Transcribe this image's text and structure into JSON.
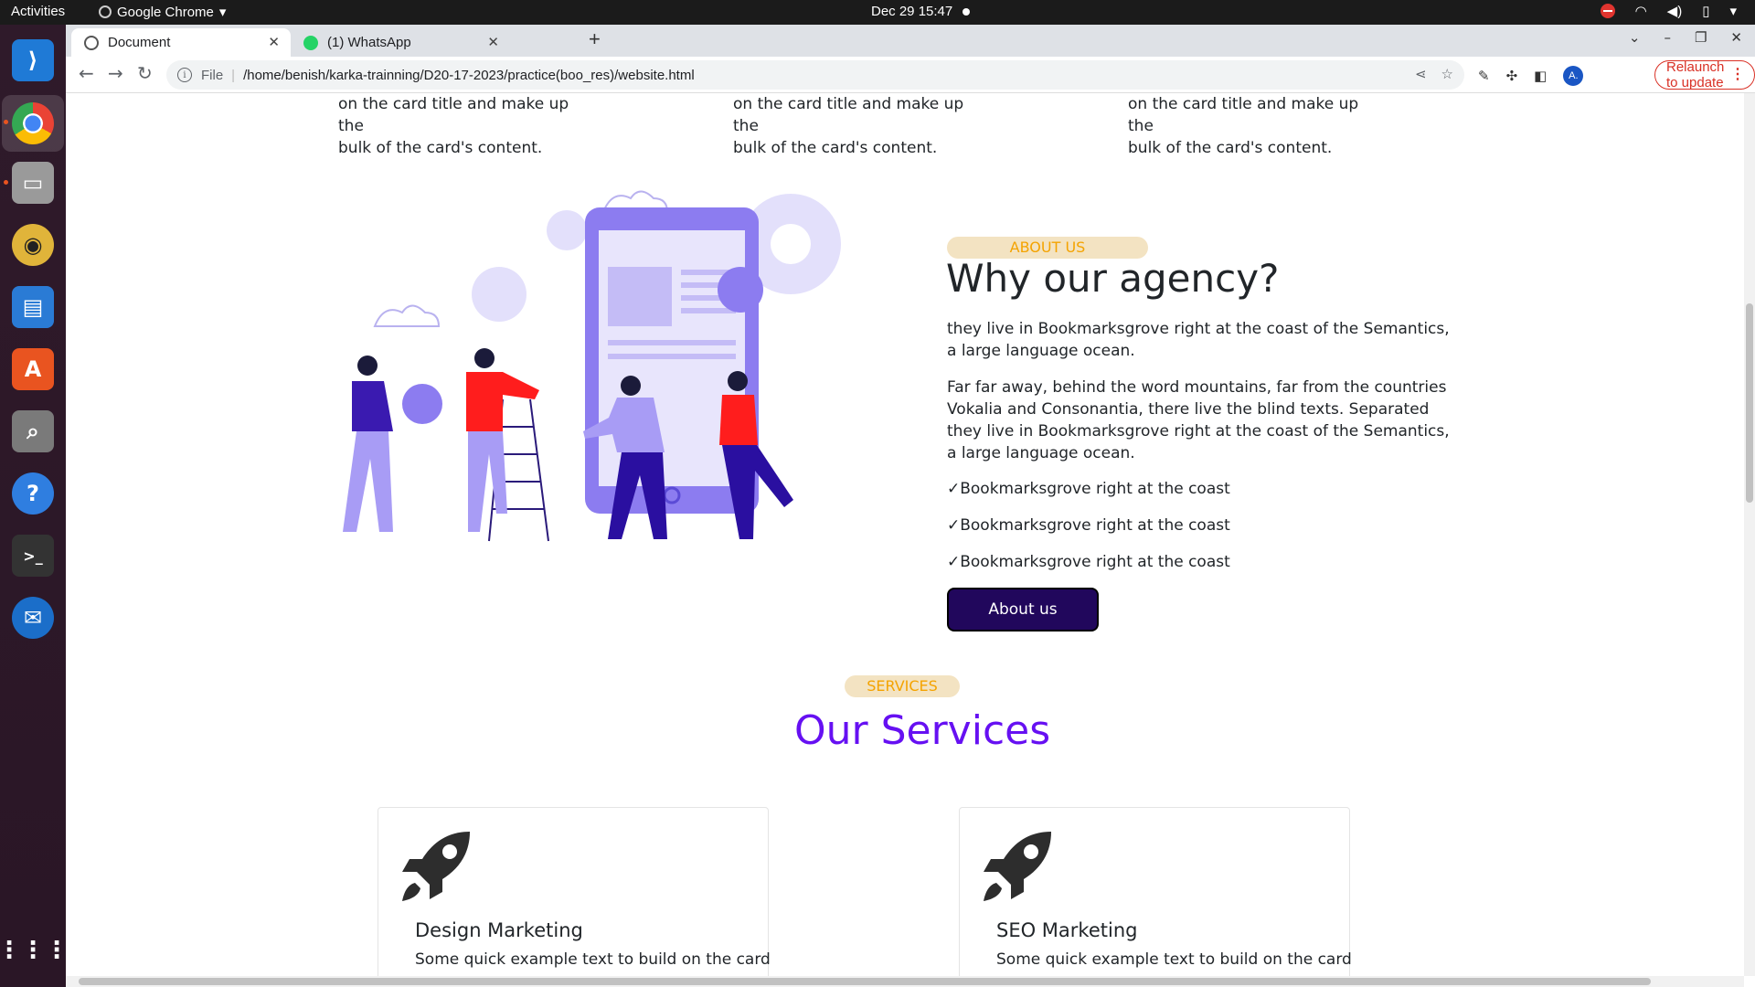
{
  "system_bar": {
    "activities": "Activities",
    "app_name": "Google Chrome",
    "clock": "Dec 29  15:47"
  },
  "browser": {
    "tabs": [
      {
        "title": "Document",
        "active": true
      },
      {
        "title": "(1) WhatsApp",
        "active": false
      }
    ],
    "address": {
      "scheme_label": "File",
      "url": "/home/benish/karka-trainning/D20-17-2023/practice(boo_res)/website.html"
    },
    "relaunch_label": "Relaunch to update",
    "profile_initial": "A."
  },
  "page": {
    "cards_tail": [
      {
        "line1": "on the card title and make up the",
        "line2": "bulk of the card's content."
      },
      {
        "line1": "on the card title and make up the",
        "line2": "bulk of the card's content."
      },
      {
        "line1": "on the card title and make up the",
        "line2": "bulk of the card's content."
      }
    ],
    "about": {
      "badge": "ABOUT US",
      "heading": "Why our agency?",
      "para1": "they live in Bookmarksgrove right at the coast of the Semantics, a large language ocean.",
      "para2": "Far far away, behind the word mountains, far from the countries Vokalia and Consonantia, there live the blind texts. Separated they live in Bookmarksgrove right at the coast of the Semantics, a large language ocean.",
      "checks": [
        "✓Bookmarksgrove right at the coast",
        "✓Bookmarksgrove right at the coast",
        "✓Bookmarksgrove right at the coast"
      ],
      "button": "About us"
    },
    "services": {
      "badge": "SERVICES",
      "title": "Our Services",
      "cards": [
        {
          "name": "Design Marketing",
          "desc": "Some quick example text to build on the card",
          "icon": "rocket-icon"
        },
        {
          "name": "SEO Marketing",
          "desc": "Some quick example text to build on the card",
          "icon": "rocket-icon"
        }
      ]
    }
  },
  "colors": {
    "accent_purple": "#6610f2",
    "button_dark": "#21075c",
    "badge_bg": "#f3e3c2",
    "badge_text": "#f4a300",
    "illustration_purple": "#8c7cf0",
    "illustration_red": "#ff1d1d"
  }
}
